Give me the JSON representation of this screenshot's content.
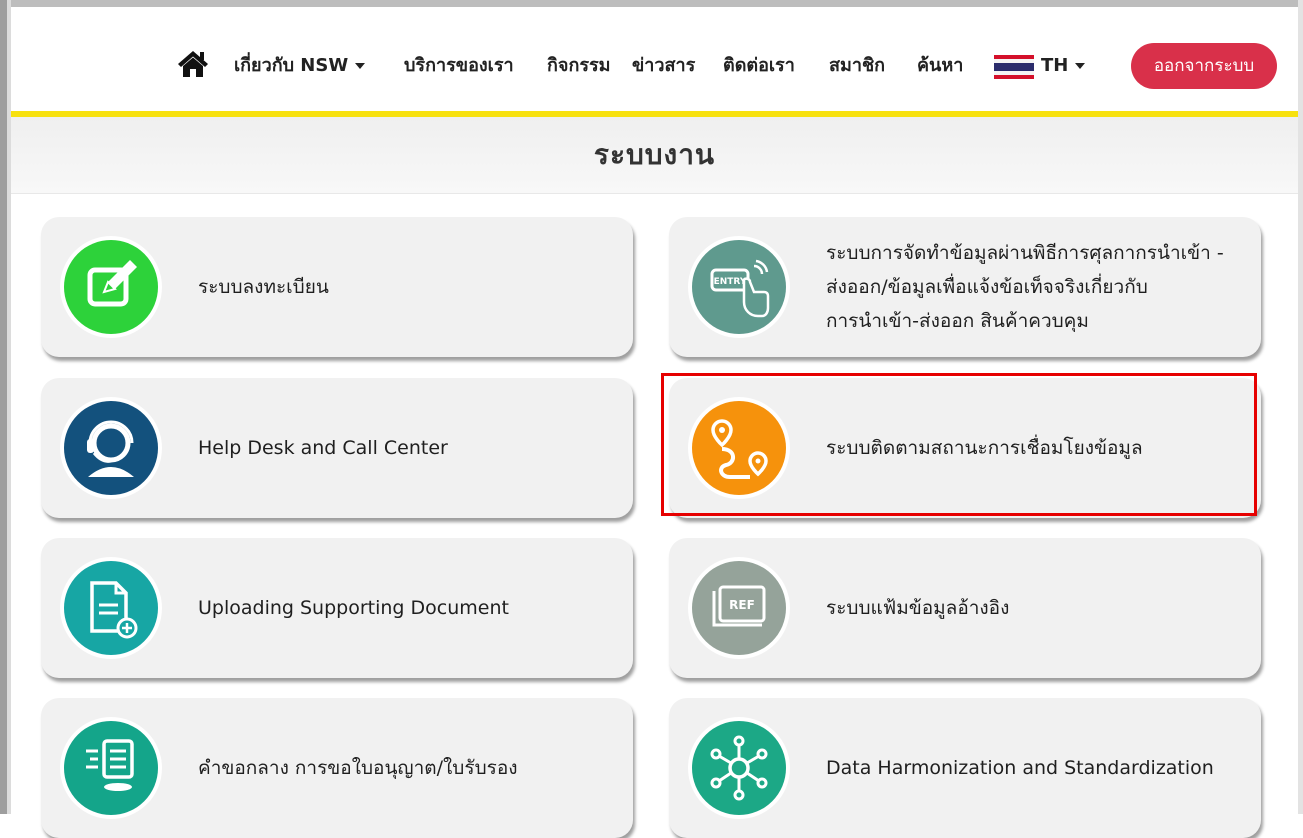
{
  "nav": {
    "home_icon": "home-icon",
    "items": [
      "เกี่ยวกับ NSW",
      "บริการของเรา",
      "กิจกรรม",
      "ข่าวสาร",
      "ติดต่อเรา",
      "สมาชิก",
      "ค้นหา"
    ],
    "language": "TH",
    "logout": "ออกจากระบบ"
  },
  "page": {
    "title": "ระบบงาน"
  },
  "cards": [
    {
      "label": "ระบบลงทะเบียน",
      "icon": "edit-form-icon",
      "color": "#2dd23a"
    },
    {
      "label": "ระบบการจัดทำข้อมูลผ่านพิธีการศุลกากรนำเข้า - ส่งออก/ข้อมูลเพื่อแจ้งข้อเท็จจริงเกี่ยวกับ การนำเข้า-ส่งออก สินค้าควบคุม",
      "lines": [
        "ระบบการจัดทำข้อมูลผ่านพิธีการศุลกากรนำเข้า -",
        "ส่งออก/ข้อมูลเพื่อแจ้งข้อเท็จจริงเกี่ยวกับ",
        "การนำเข้า-ส่งออก สินค้าควบคุม"
      ],
      "icon": "entry-touch-icon",
      "icon_text": "ENTRY",
      "color": "#5f9a8e"
    },
    {
      "label": "Help Desk and Call Center",
      "icon": "headset-user-icon",
      "color": "#13517d"
    },
    {
      "label": "ระบบติดตามสถานะการเชื่อมโยงข้อมูล",
      "icon": "route-tracking-icon",
      "color": "#f6920c"
    },
    {
      "label": "Uploading Supporting Document",
      "icon": "document-upload-icon",
      "color": "#17a6a4"
    },
    {
      "label": "ระบบแฟ้มข้อมูลอ้างอิง",
      "icon": "reference-file-icon",
      "icon_text": "REF",
      "color": "#95a39a"
    },
    {
      "label": "คำขอกลาง การขอใบอนุญาต/ใบรับรอง",
      "icon": "computer-form-icon",
      "color": "#14a58a"
    },
    {
      "label": "Data Harmonization and Standardization",
      "icon": "network-nodes-icon",
      "color": "#1ca886"
    }
  ],
  "colors": {
    "yellow_line": "#f7e10e",
    "logout_bg": "#d9304a",
    "highlight": "#e60000"
  }
}
